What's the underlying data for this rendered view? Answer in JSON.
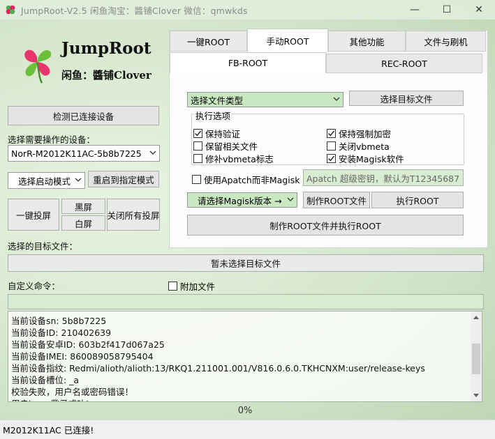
{
  "window": {
    "title": "JumpRoot-V2.5 闲鱼淘宝：醬铺Clover 微信：qmwkds",
    "minimize": "—",
    "maximize": "☐",
    "close": "✕"
  },
  "logo": {
    "title": "JumpRoot",
    "subtitle": "闲鱼：醬铺Clover"
  },
  "left": {
    "detect_button": "检测已连接设备",
    "device_label": "选择需要操作的设备：",
    "device_selected": "NorR-M2012K11AC-5b8b7225",
    "boot_mode_selected": "选择启动模式",
    "reboot_button": "重启到指定模式",
    "one_click_cast": "一键投屏",
    "black_screen": "黑屏",
    "white_screen": "白屏",
    "close_all_cast": "关闭所有投屏",
    "target_file_label": "选择的目标文件：",
    "target_file_button": "暂未选择目标文件",
    "custom_cmd_label": "自定义命令：",
    "attach_file_label": "附加文件",
    "attach_file_checked": false,
    "custom_cmd_value": ""
  },
  "tabs": [
    {
      "label": "一键ROOT",
      "active": false
    },
    {
      "label": "手动ROOT",
      "active": true
    },
    {
      "label": "其他功能",
      "active": false
    },
    {
      "label": "文件与刷机",
      "active": false
    }
  ],
  "subtabs": [
    {
      "label": "FB-ROOT",
      "active": true
    },
    {
      "label": "REC-ROOT",
      "active": false
    }
  ],
  "fbroot": {
    "file_type_selected": "选择文件类型",
    "select_target_button": "选择目标文件",
    "options_legend": "执行选项",
    "options": [
      {
        "label": "保持验证",
        "checked": true
      },
      {
        "label": "保持强制加密",
        "checked": true
      },
      {
        "label": "保留相关文件",
        "checked": false
      },
      {
        "label": "关闭vbmeta",
        "checked": false
      },
      {
        "label": "修补vbmeta标志",
        "checked": false
      },
      {
        "label": "安装Magisk软件",
        "checked": true
      }
    ],
    "use_apatch_label": "使用Apatch而非Magisk",
    "use_apatch_checked": false,
    "apatch_key_placeholder": "Apatch 超级密钥，默认为T12345687",
    "magisk_version_selected": "请选择Magisk版本 →",
    "make_root_file_button": "制作ROOT文件",
    "execute_root_button": "执行ROOT",
    "make_and_execute_button": "制作ROOT文件并执行ROOT"
  },
  "log": [
    "当前设备sn:  5b8b7225",
    "当前设备ID:  210402639",
    "当前设备安卓ID:  603b2f417d067a25",
    "当前设备IMEI:  860089058795404",
    "当前设备指纹:  Redmi/alioth/alioth:13/RKQ1.211001.001/V816.0.6.0.TKHCNXM:user/release-keys",
    "当前设备槽位:  _a",
    "校验失败，用户名或密码错误！",
    "用户jump登录成功!"
  ],
  "progress": {
    "text": "0%",
    "value": 0
  },
  "status": "M2012K11AC 已连接!",
  "colors": {
    "accent_green": "#c9e8c2",
    "checkbox_check": "#222222"
  }
}
